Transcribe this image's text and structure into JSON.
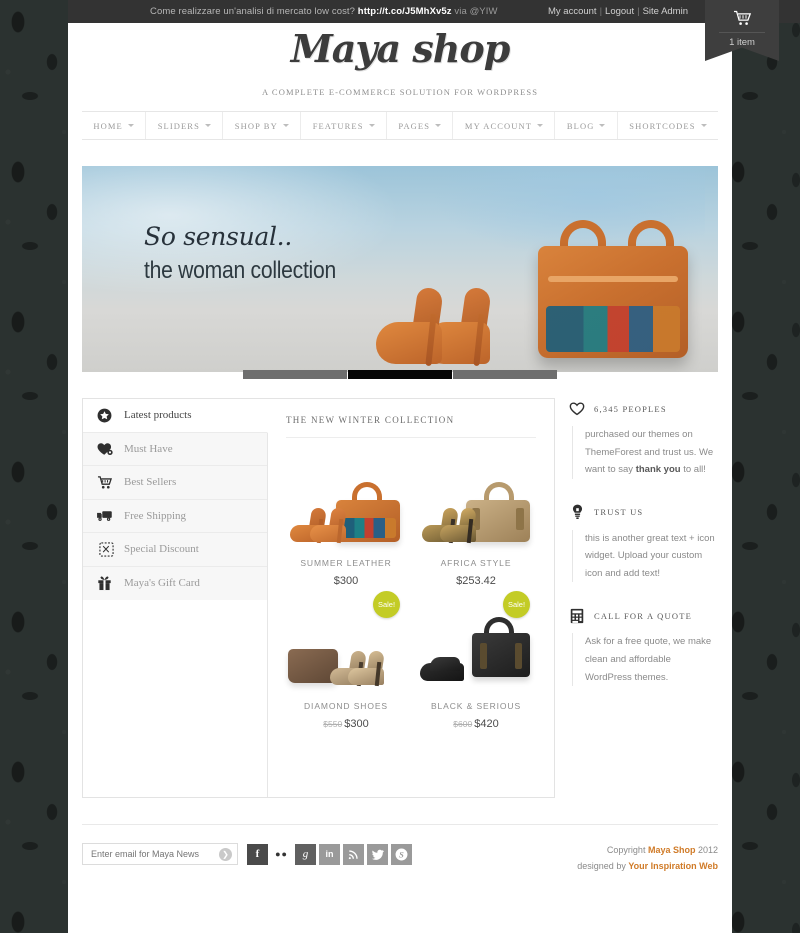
{
  "topbar": {
    "tweet_prefix": "Come realizzare un'analisi di mercato low cost? ",
    "tweet_link": "http://t.co/J5MhXv5z",
    "tweet_via": " via @YIW",
    "my_account": "My account",
    "logout": "Logout",
    "site_admin": "Site Admin",
    "separator": "|"
  },
  "cart": {
    "icon": "shopping-cart-icon",
    "count_label": "1 item"
  },
  "header": {
    "logo": "Maya shop",
    "tagline": "A COMPLETE E-COMMERCE SOLUTION FOR WORDPRESS"
  },
  "nav": {
    "items": [
      {
        "label": "HOME"
      },
      {
        "label": "SLIDERS"
      },
      {
        "label": "SHOP BY"
      },
      {
        "label": "FEATURES"
      },
      {
        "label": "PAGES"
      },
      {
        "label": "MY ACCOUNT"
      },
      {
        "label": "BLOG"
      },
      {
        "label": "SHORTCODES"
      }
    ]
  },
  "slider": {
    "caption_line1": "So sensual..",
    "caption_line2": "the woman collection",
    "pager": [
      {
        "active": false
      },
      {
        "active": true
      },
      {
        "active": false
      }
    ]
  },
  "tabs": {
    "items": [
      {
        "label": "Latest products",
        "icon": "star-badge-icon",
        "active": true
      },
      {
        "label": "Must Have",
        "icon": "heart-icon",
        "active": false
      },
      {
        "label": "Best Sellers",
        "icon": "cart-icon",
        "active": false
      },
      {
        "label": "Free Shipping",
        "icon": "truck-icon",
        "active": false
      },
      {
        "label": "Special Discount",
        "icon": "scissors-icon",
        "active": false
      },
      {
        "label": "Maya's Gift Card",
        "icon": "gift-icon",
        "active": false
      }
    ]
  },
  "products": {
    "panel_title": "THE NEW WINTER COLLECTION",
    "items": [
      {
        "name": "SUMMER LEATHER",
        "price": "$300",
        "old_price": "",
        "sale": false,
        "sale_label": ""
      },
      {
        "name": "AFRICA STYLE",
        "price": "$253.42",
        "old_price": "",
        "sale": false,
        "sale_label": ""
      },
      {
        "name": "DIAMOND SHOES",
        "price": "$300",
        "old_price": "$550",
        "sale": true,
        "sale_label": "Sale!"
      },
      {
        "name": "BLACK & SERIOUS",
        "price": "$420",
        "old_price": "$600",
        "sale": true,
        "sale_label": "Sale!"
      }
    ]
  },
  "sidebar": {
    "widgets": [
      {
        "title": "6,345 PEOPLES",
        "icon": "heart-icon",
        "body_1": "purchased our themes on ThemeForest and trust us. We want to say ",
        "body_bold": "thank you",
        "body_2": " to all!"
      },
      {
        "title": "TRUST US",
        "icon": "lightbulb-icon",
        "body_1": "this is another great text + icon widget. Upload your custom icon and add text!",
        "body_bold": "",
        "body_2": ""
      },
      {
        "title": "CALL FOR A QUOTE",
        "icon": "calculator-icon",
        "body_1": "Ask for a free quote, we make clean and affordable WordPress themes.",
        "body_bold": "",
        "body_2": ""
      }
    ]
  },
  "footer": {
    "newsletter_placeholder": "Enter email for Maya News",
    "newsletter_value": "",
    "submit_icon": "arrow-right-icon",
    "social": [
      {
        "name": "facebook",
        "glyph": "f",
        "color": "#4a4a4a"
      },
      {
        "name": "flickr",
        "glyph": "●●",
        "color": "#ffffff"
      },
      {
        "name": "google-plus",
        "glyph": "g",
        "color": "#606060"
      },
      {
        "name": "linkedin",
        "glyph": "in",
        "color": "#9a9a9a"
      },
      {
        "name": "rss",
        "glyph": "◔",
        "color": "#9a9a9a"
      },
      {
        "name": "twitter",
        "glyph": "t",
        "color": "#9a9a9a"
      },
      {
        "name": "skype",
        "glyph": "S",
        "color": "#9a9a9a"
      }
    ],
    "copyright_pre": "Copyright ",
    "copyright_brand": "Maya Shop",
    "copyright_year": " 2012",
    "designed_pre": "designed by ",
    "designed_brand": "Your Inspiration Web"
  },
  "colors": {
    "accent": "#d07b28",
    "sale_badge": "#c3cc26",
    "page_bg": "#2b3230",
    "topbar_bg": "#333333"
  }
}
